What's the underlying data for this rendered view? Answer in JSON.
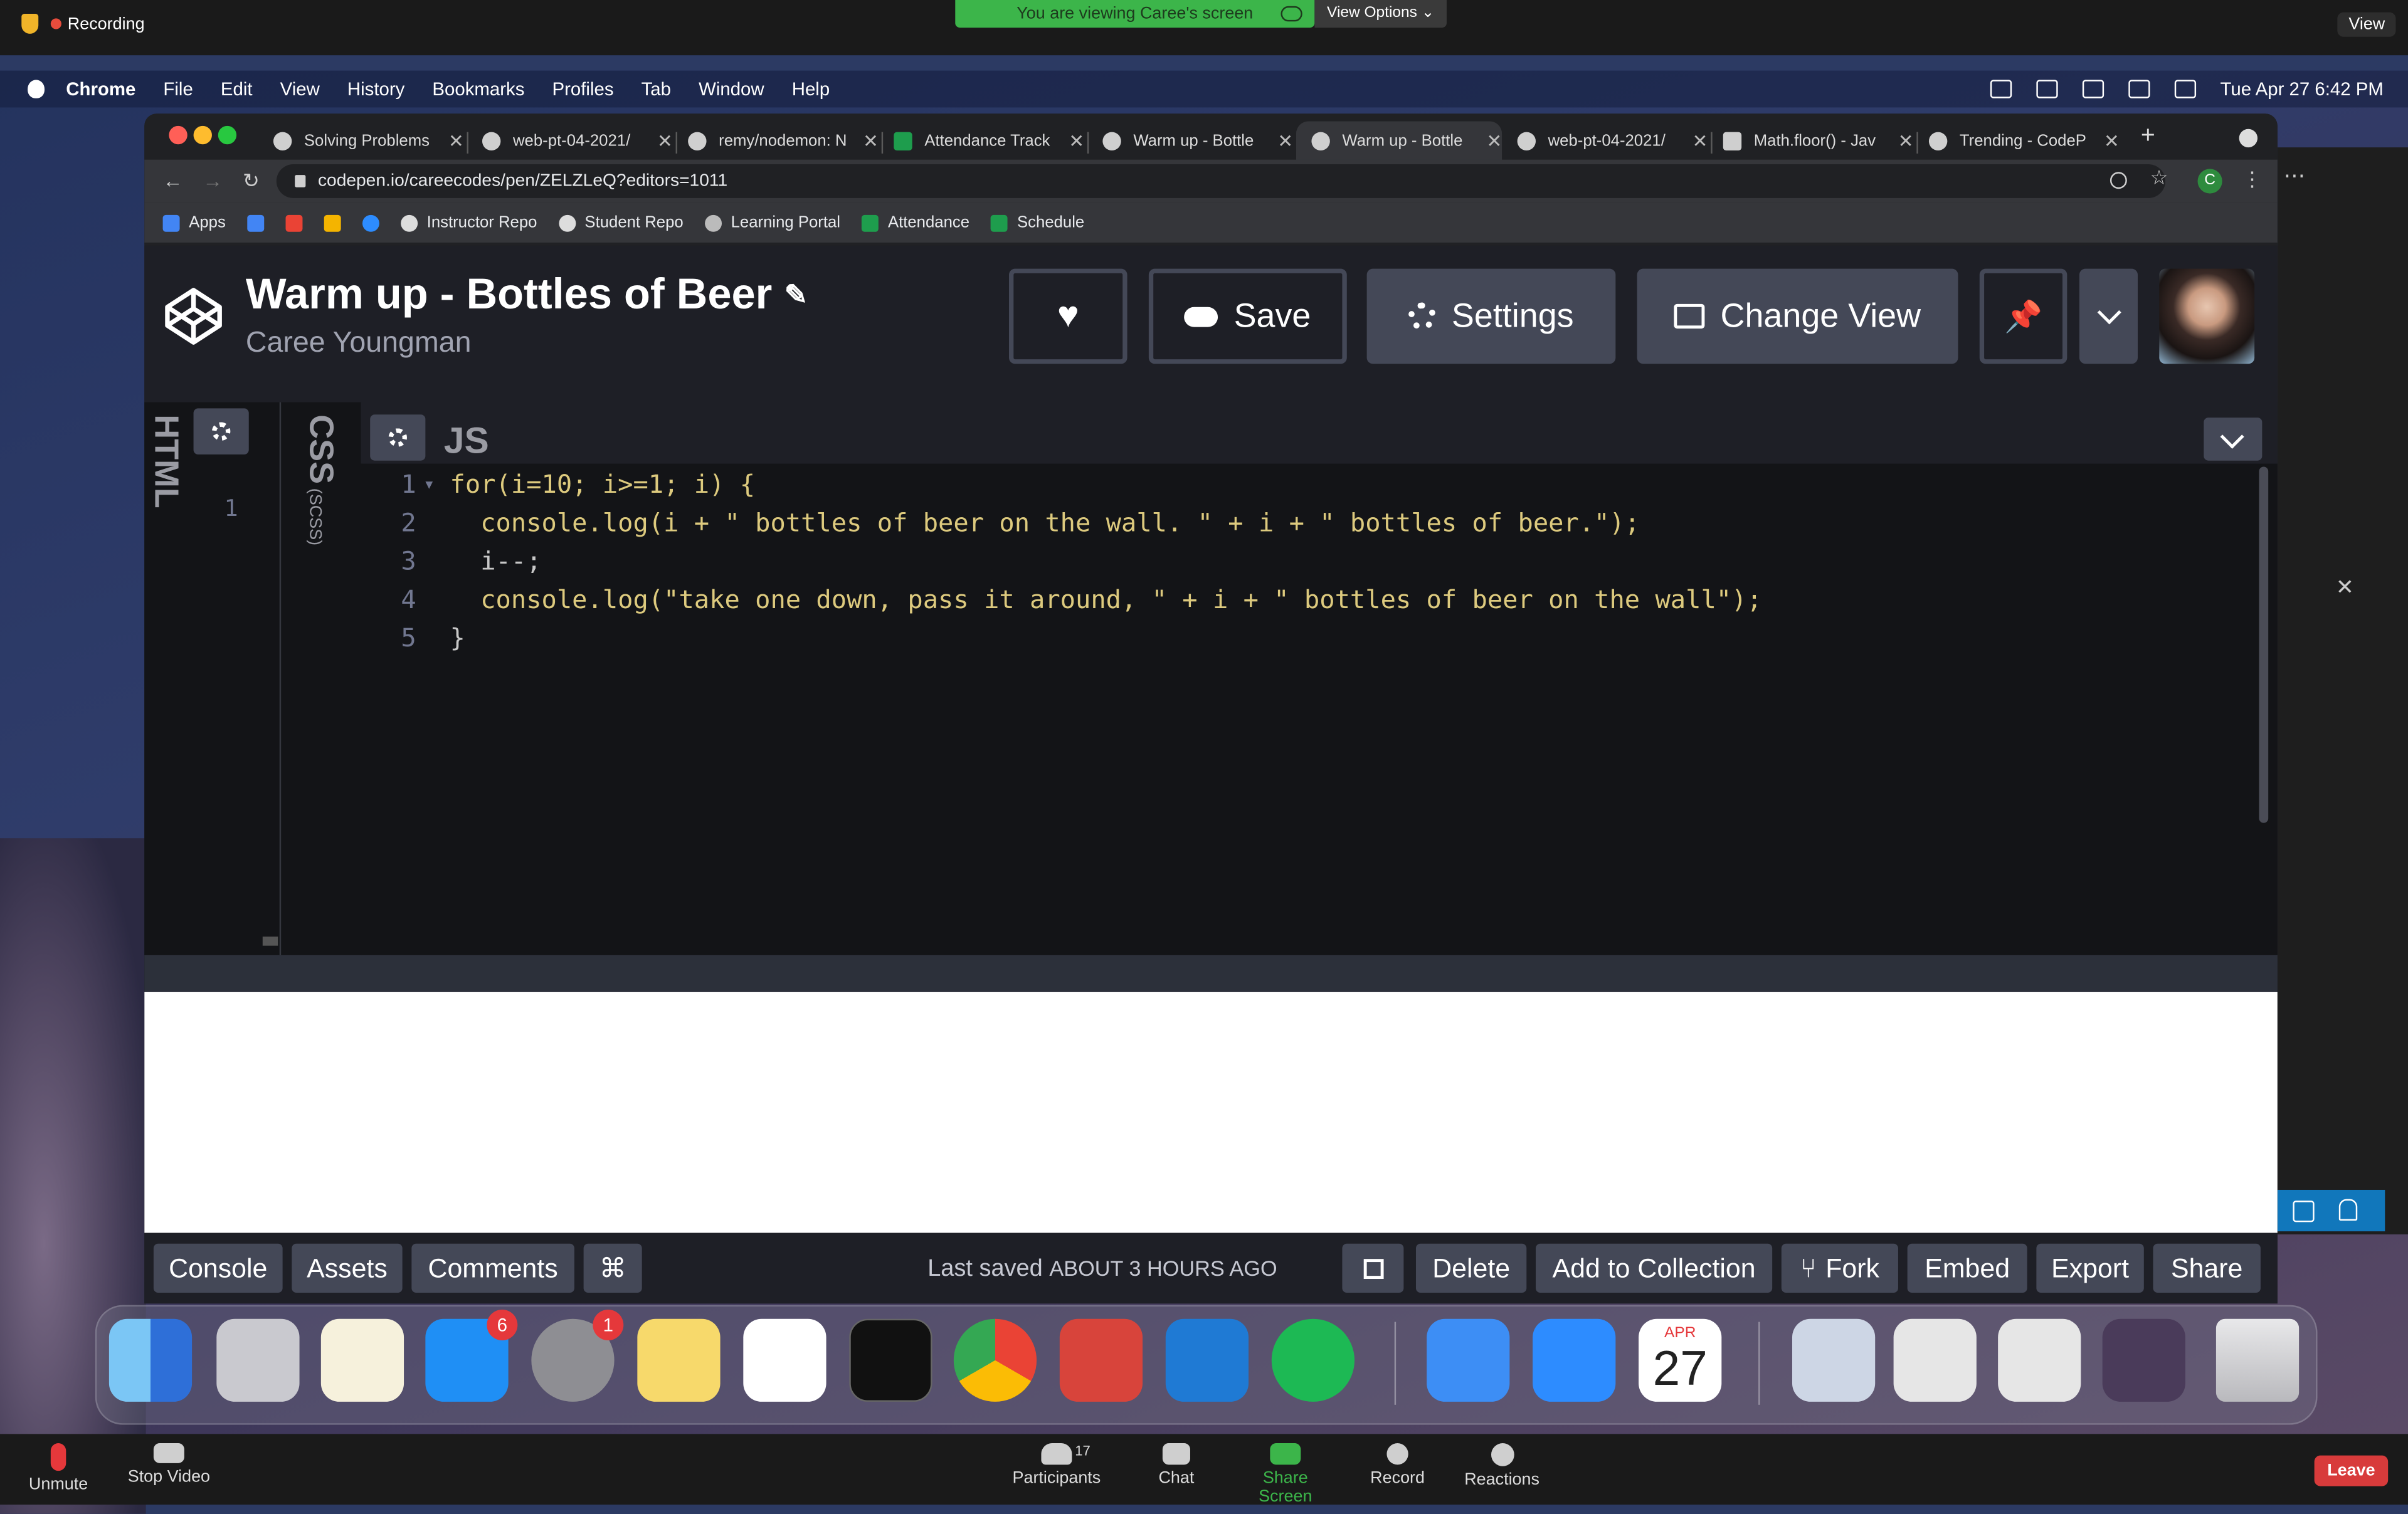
{
  "zoom_top": {
    "recording": "Recording",
    "viewing_banner": "You are viewing Caree's screen",
    "view_options": "View Options ⌄",
    "view_button": "View"
  },
  "menubar": {
    "items": [
      "Chrome",
      "File",
      "Edit",
      "View",
      "History",
      "Bookmarks",
      "Profiles",
      "Tab",
      "Window",
      "Help"
    ],
    "clock": "Tue Apr 27  6:42 PM"
  },
  "tabs": [
    {
      "title": "Solving Problems"
    },
    {
      "title": "web-pt-04-2021/"
    },
    {
      "title": "remy/nodemon: N"
    },
    {
      "title": "Attendance Track"
    },
    {
      "title": "Warm up - Bottle"
    },
    {
      "title": "Warm up - Bottle"
    },
    {
      "title": "web-pt-04-2021/"
    },
    {
      "title": "Math.floor() - Jav"
    },
    {
      "title": "Trending - CodeP"
    }
  ],
  "url": "codepen.io/careecodes/pen/ZELZLeQ?editors=1011",
  "profile_initial": "C",
  "bookmarks": [
    "Apps",
    "Instructor Repo",
    "Student Repo",
    "Learning Portal",
    "Attendance",
    "Schedule"
  ],
  "pen": {
    "title": "Warm up - Bottles of Beer",
    "author": "Caree Youngman",
    "buttons": {
      "save": "Save",
      "settings": "Settings",
      "change_view": "Change View"
    }
  },
  "editors": {
    "html_label": "HTML",
    "css_label": "CSS",
    "css_sub": "(SCSS)",
    "js_label": "JS",
    "html_line_number": "1",
    "code_lines": [
      {
        "n": "1",
        "text": "for(i=10; i>=1; i) {"
      },
      {
        "n": "2",
        "text": "  console.log(i + \" bottles of beer on the wall. \" + i + \" bottles of beer.\");"
      },
      {
        "n": "3",
        "text": "  i--;"
      },
      {
        "n": "4",
        "text": "  console.log(\"take one down, pass it around, \" + i + \" bottles of beer on the wall\");"
      },
      {
        "n": "5",
        "text": "}"
      }
    ]
  },
  "footer": {
    "console": "Console",
    "assets": "Assets",
    "comments": "Comments",
    "shortcut": "⌘",
    "last_saved_prefix": "Last saved ",
    "last_saved_when": "ABOUT 3 HOURS AGO",
    "delete": "Delete",
    "add_to_collection": "Add to Collection",
    "fork": "Fork",
    "embed": "Embed",
    "export": "Export",
    "share": "Share"
  },
  "dock": {
    "app_store_badge": "6",
    "settings_badge": "1",
    "calendar_month": "APR",
    "calendar_day": "27"
  },
  "zoom_bottom": {
    "unmute": "Unmute",
    "stop_video": "Stop Video",
    "participants": "Participants",
    "participants_count": "17",
    "chat": "Chat",
    "share_screen": "Share Screen",
    "record": "Record",
    "reactions": "Reactions",
    "leave": "Leave"
  }
}
